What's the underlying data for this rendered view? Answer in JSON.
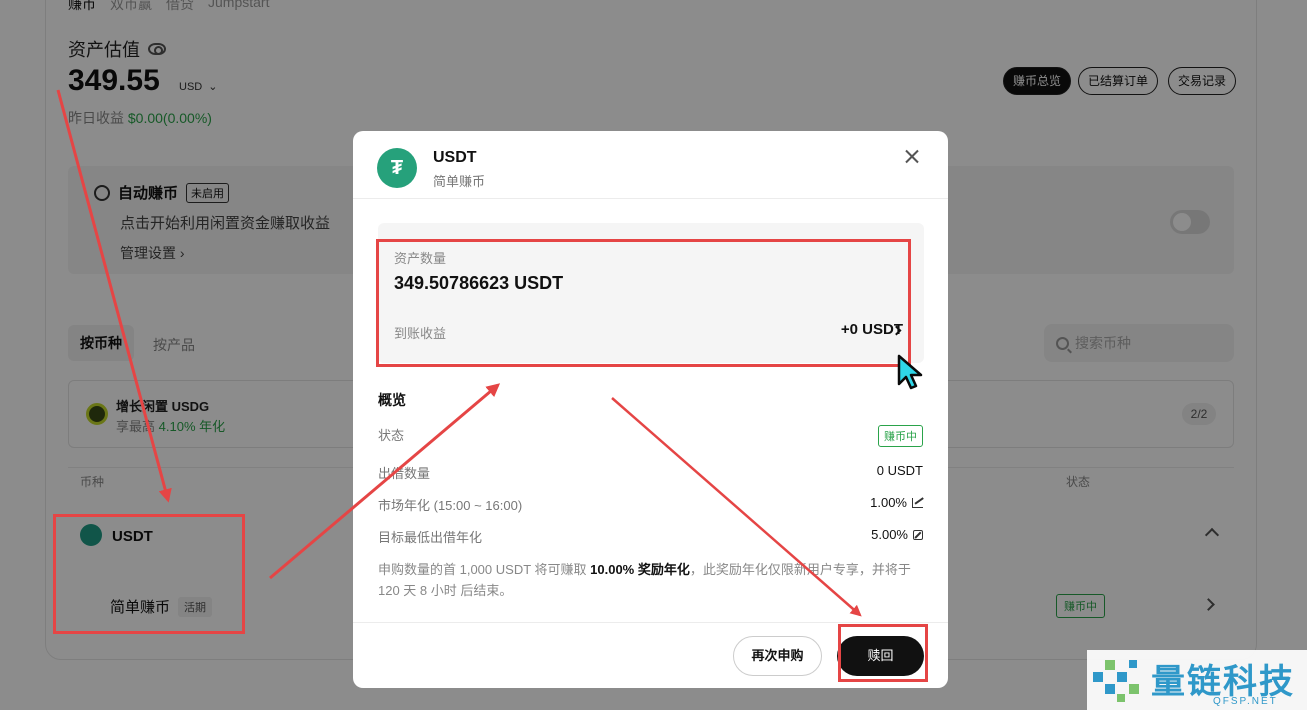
{
  "background": {
    "topnav": [
      "赚币",
      "双币赢",
      "借贷",
      "Jumpstart"
    ],
    "asset_label": "资产估值",
    "asset_value": "349.55",
    "asset_unit": "USD",
    "yesterday_label": "昨日收益",
    "yesterday_value": "$0.00(0.00%)",
    "pills": [
      "赚币总览",
      "已结算订单",
      "交易记录"
    ],
    "auto_earn": {
      "title": "自动赚币",
      "tag": "未启用",
      "subtitle": "点击开始利用闲置资金赚取收益",
      "manage": "管理设置"
    },
    "tabs": [
      "按币种",
      "按产品"
    ],
    "search_placeholder": "搜索币种",
    "promo": {
      "title": "增长闲置 USDG",
      "subtitle_prefix": "享最高",
      "subtitle_value": "4.10% 年化",
      "count": "2/2"
    },
    "columns": {
      "coin": "币种",
      "status": "状态"
    },
    "row": {
      "coin": "USDT",
      "product": "简单赚币",
      "product_tag": "活期",
      "status": "赚币中"
    }
  },
  "modal": {
    "title": "USDT",
    "subtitle": "简单赚币",
    "asset_label": "资产数量",
    "asset_value": "349.50786623 USDT",
    "earn_label": "到账收益",
    "earn_value": "+0 USDT",
    "overview_title": "概览",
    "overview_rows": [
      {
        "label": "状态",
        "value": "赚币中"
      },
      {
        "label": "出借数量",
        "value": "0 USDT"
      },
      {
        "label": "市场年化 (15:00 ~ 16:00)",
        "value": "1.00%"
      },
      {
        "label": "目标最低出借年化",
        "value": "5.00%"
      }
    ],
    "note_part1": "申购数量的首 1,000 USDT 将可赚取 ",
    "note_bold": "10.00% 奖励年化",
    "note_part2": "，此奖励年化仅限新用户专享，并将于 120 天 8 小时 后结束。",
    "btn_again": "再次申购",
    "btn_redeem": "赎回"
  },
  "watermark": {
    "text": "量链科技",
    "url": "QFSP.NET"
  },
  "colors": {
    "annotation_red": "#e54545",
    "tether_green": "#26a17b",
    "status_green": "#2aa34a",
    "watermark_blue": "#2f98c9"
  }
}
